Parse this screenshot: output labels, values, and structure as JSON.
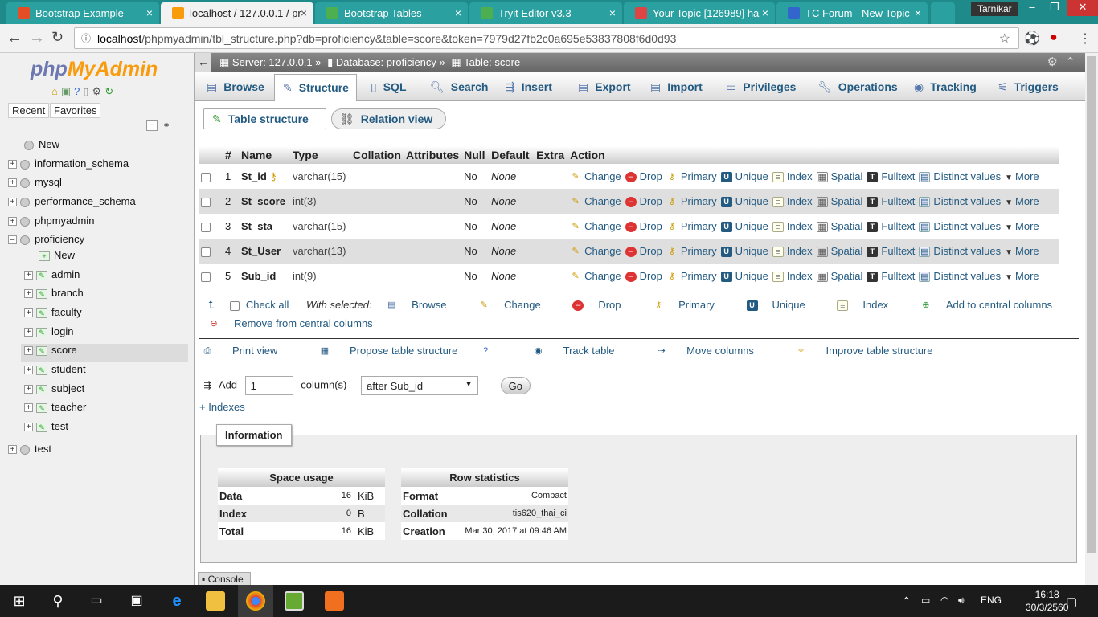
{
  "browser": {
    "tabs": [
      {
        "title": "Bootstrap Example",
        "color": "#e44d26"
      },
      {
        "title": "localhost / 127.0.0.1 / pr",
        "color": "#f89c0e"
      },
      {
        "title": "Bootstrap Tables",
        "color": "#4caf50"
      },
      {
        "title": "Tryit Editor v3.3",
        "color": "#4caf50"
      },
      {
        "title": "Your Topic [126989] ha",
        "color": "#d44"
      },
      {
        "title": "TC Forum - New Topic",
        "color": "#3366cc"
      }
    ],
    "user": "Tarnikar",
    "url_host": "localhost",
    "url_path": "/phpmyadmin/tbl_structure.php?db=proficiency&table=score&token=7979d27fb2c0a695e53837808f6d0d93"
  },
  "sidebar": {
    "logo_php": "php",
    "logo_myadmin": "MyAdmin",
    "recent": "Recent",
    "favorites": "Favorites",
    "tree": [
      {
        "label": "New",
        "level": 0,
        "type": "new"
      },
      {
        "label": "information_schema",
        "level": 0,
        "type": "db"
      },
      {
        "label": "mysql",
        "level": 0,
        "type": "db"
      },
      {
        "label": "performance_schema",
        "level": 0,
        "type": "db"
      },
      {
        "label": "phpmyadmin",
        "level": 0,
        "type": "db"
      },
      {
        "label": "proficiency",
        "level": 0,
        "type": "db-open"
      },
      {
        "label": "New",
        "level": 1,
        "type": "new"
      },
      {
        "label": "admin",
        "level": 1,
        "type": "table"
      },
      {
        "label": "branch",
        "level": 1,
        "type": "table"
      },
      {
        "label": "faculty",
        "level": 1,
        "type": "table"
      },
      {
        "label": "login",
        "level": 1,
        "type": "table"
      },
      {
        "label": "score",
        "level": 1,
        "type": "table",
        "selected": true
      },
      {
        "label": "student",
        "level": 1,
        "type": "table"
      },
      {
        "label": "subject",
        "level": 1,
        "type": "table"
      },
      {
        "label": "teacher",
        "level": 1,
        "type": "table"
      },
      {
        "label": "test",
        "level": 1,
        "type": "table"
      },
      {
        "label": "test",
        "level": 0,
        "type": "db"
      }
    ]
  },
  "breadcrumb": {
    "server": "Server: 127.0.0.1 »",
    "database": "Database: proficiency »",
    "table": "Table: score"
  },
  "menu_tabs": [
    "Browse",
    "Structure",
    "SQL",
    "Search",
    "Insert",
    "Export",
    "Import",
    "Privileges",
    "Operations",
    "Tracking",
    "Triggers"
  ],
  "sub_tabs": {
    "structure": "Table structure",
    "relation": "Relation view"
  },
  "structure_table": {
    "headers": [
      "#",
      "Name",
      "Type",
      "Collation",
      "Attributes",
      "Null",
      "Default",
      "Extra",
      "Action"
    ],
    "rows": [
      {
        "num": "1",
        "name": "St_id",
        "type": "varchar(15)",
        "collation": "",
        "attributes": "",
        "null": "No",
        "default": "None",
        "extra": "",
        "primary_key": true
      },
      {
        "num": "2",
        "name": "St_score",
        "type": "int(3)",
        "collation": "",
        "attributes": "",
        "null": "No",
        "default": "None",
        "extra": ""
      },
      {
        "num": "3",
        "name": "St_sta",
        "type": "varchar(15)",
        "collation": "",
        "attributes": "",
        "null": "No",
        "default": "None",
        "extra": ""
      },
      {
        "num": "4",
        "name": "St_User",
        "type": "varchar(13)",
        "collation": "",
        "attributes": "",
        "null": "No",
        "default": "None",
        "extra": ""
      },
      {
        "num": "5",
        "name": "Sub_id",
        "type": "int(9)",
        "collation": "",
        "attributes": "",
        "null": "No",
        "default": "None",
        "extra": ""
      }
    ],
    "actions": [
      "Change",
      "Drop",
      "Primary",
      "Unique",
      "Index",
      "Spatial",
      "Fulltext",
      "Distinct values",
      "More"
    ]
  },
  "bulk": {
    "check_all": "Check all",
    "with_selected": "With selected:",
    "actions": [
      "Browse",
      "Change",
      "Drop",
      "Primary",
      "Unique",
      "Index",
      "Add to central columns"
    ],
    "remove_central": "Remove from central columns"
  },
  "tools": [
    "Print view",
    "Propose table structure",
    "Track table",
    "Move columns",
    "Improve table structure"
  ],
  "add_columns": {
    "label": "Add",
    "count": "1",
    "unit": "column(s)",
    "position": "after Sub_id",
    "go": "Go"
  },
  "indexes_link": "+ Indexes",
  "information": {
    "legend": "Information",
    "space_usage": {
      "title": "Space usage",
      "rows": [
        {
          "label": "Data",
          "value": "16",
          "unit": "KiB"
        },
        {
          "label": "Index",
          "value": "0",
          "unit": "B"
        },
        {
          "label": "Total",
          "value": "16",
          "unit": "KiB"
        }
      ]
    },
    "row_statistics": {
      "title": "Row statistics",
      "rows": [
        {
          "label": "Format",
          "value": "Compact"
        },
        {
          "label": "Collation",
          "value": "tis620_thai_ci"
        },
        {
          "label": "Creation",
          "value": "Mar 30, 2017 at 09:46 AM"
        }
      ]
    }
  },
  "console_label": "Console",
  "taskbar": {
    "lang": "ENG",
    "time": "16:18",
    "date": "30/3/2560"
  }
}
